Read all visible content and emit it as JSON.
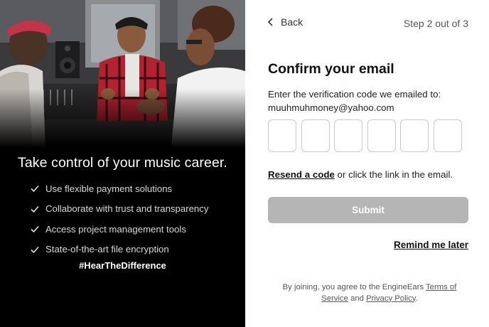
{
  "hero": {
    "photo_alt": "Three people talking in a music studio",
    "headline": "Take control of your music career.",
    "features": [
      "Use flexible payment solutions",
      "Collaborate with trust and transparency",
      "Access project management tools",
      "State-of-the-art file encryption"
    ],
    "hashtag": "#HearTheDifference"
  },
  "nav": {
    "back_label": "Back",
    "step_text": "Step 2 out of 3"
  },
  "form": {
    "title": "Confirm your email",
    "instructions": "Enter the verification code we emailed to:",
    "email": "muuhmuhmoney@yahoo.com",
    "code_digits": [
      "",
      "",
      "",
      "",
      "",
      ""
    ],
    "resend_link": "Resend a code",
    "resend_suffix": " or click the link in the email.",
    "submit_label": "Submit",
    "remind_label": "Remind me later"
  },
  "legal": {
    "prefix": "By joining, you agree to the EngineEars ",
    "terms_label": "Terms of Service",
    "and_text": " and ",
    "privacy_label": "Privacy Policy",
    "suffix": "."
  },
  "colors": {
    "left_bg": "#000000",
    "submit_disabled": "#b5b5b5",
    "box_border": "#c9c9c9"
  }
}
